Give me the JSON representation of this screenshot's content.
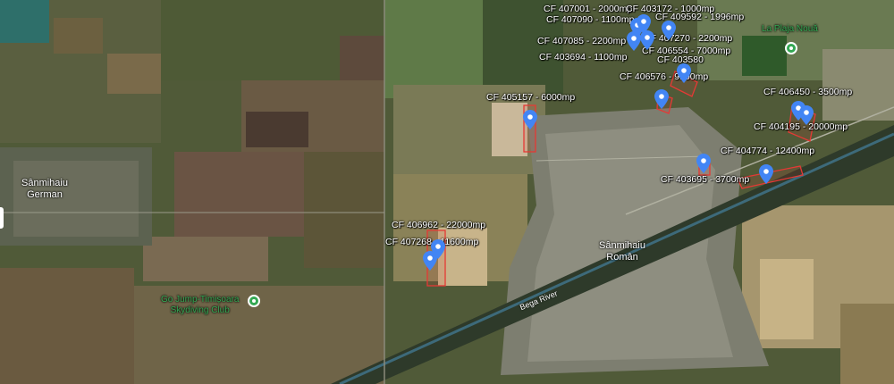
{
  "parcels": [
    {
      "label": "CF 407001 - 2000mp"
    },
    {
      "label": "CF 403172 - 1000mp"
    },
    {
      "label": "CF 407090 - 1100mp"
    },
    {
      "label": "CF 409592 - 1996mp"
    },
    {
      "label": "CF 407085 - 2200mp"
    },
    {
      "label": "CF 407270 - 2200mp"
    },
    {
      "label": "CF 403694 - 1100mp"
    },
    {
      "label": "CF 406554 - 7000mp"
    },
    {
      "label": "CF 403580"
    },
    {
      "label": "CF 406576 - 9100mp"
    },
    {
      "label": "CF 405157 - 6000mp"
    },
    {
      "label": "CF 406450 - 3500mp"
    },
    {
      "label": "CF 404195 - 20000mp"
    },
    {
      "label": "CF 404774 - 12400mp"
    },
    {
      "label": "CF 403695 - 3700mp"
    },
    {
      "label": "CF 406962 - 22000mp"
    },
    {
      "label": "CF 407268 - 11600mp"
    }
  ],
  "places": {
    "sanmihaiu_german_1": "Sânmihaiu",
    "sanmihaiu_german_2": "German",
    "sanmihaiu_roman_1": "Sânmihaiu",
    "sanmihaiu_roman_2": "Român"
  },
  "pois": {
    "la_plaja_noua": "La Plaja Nouă",
    "skydiving_1": "Go Jump-Timișoara",
    "skydiving_2": "Skydiving Club"
  },
  "water": {
    "river": "Bega River"
  },
  "colors": {
    "marker": "#4285f4",
    "parcel_outline": "#e53935",
    "poi": "#34a853"
  }
}
